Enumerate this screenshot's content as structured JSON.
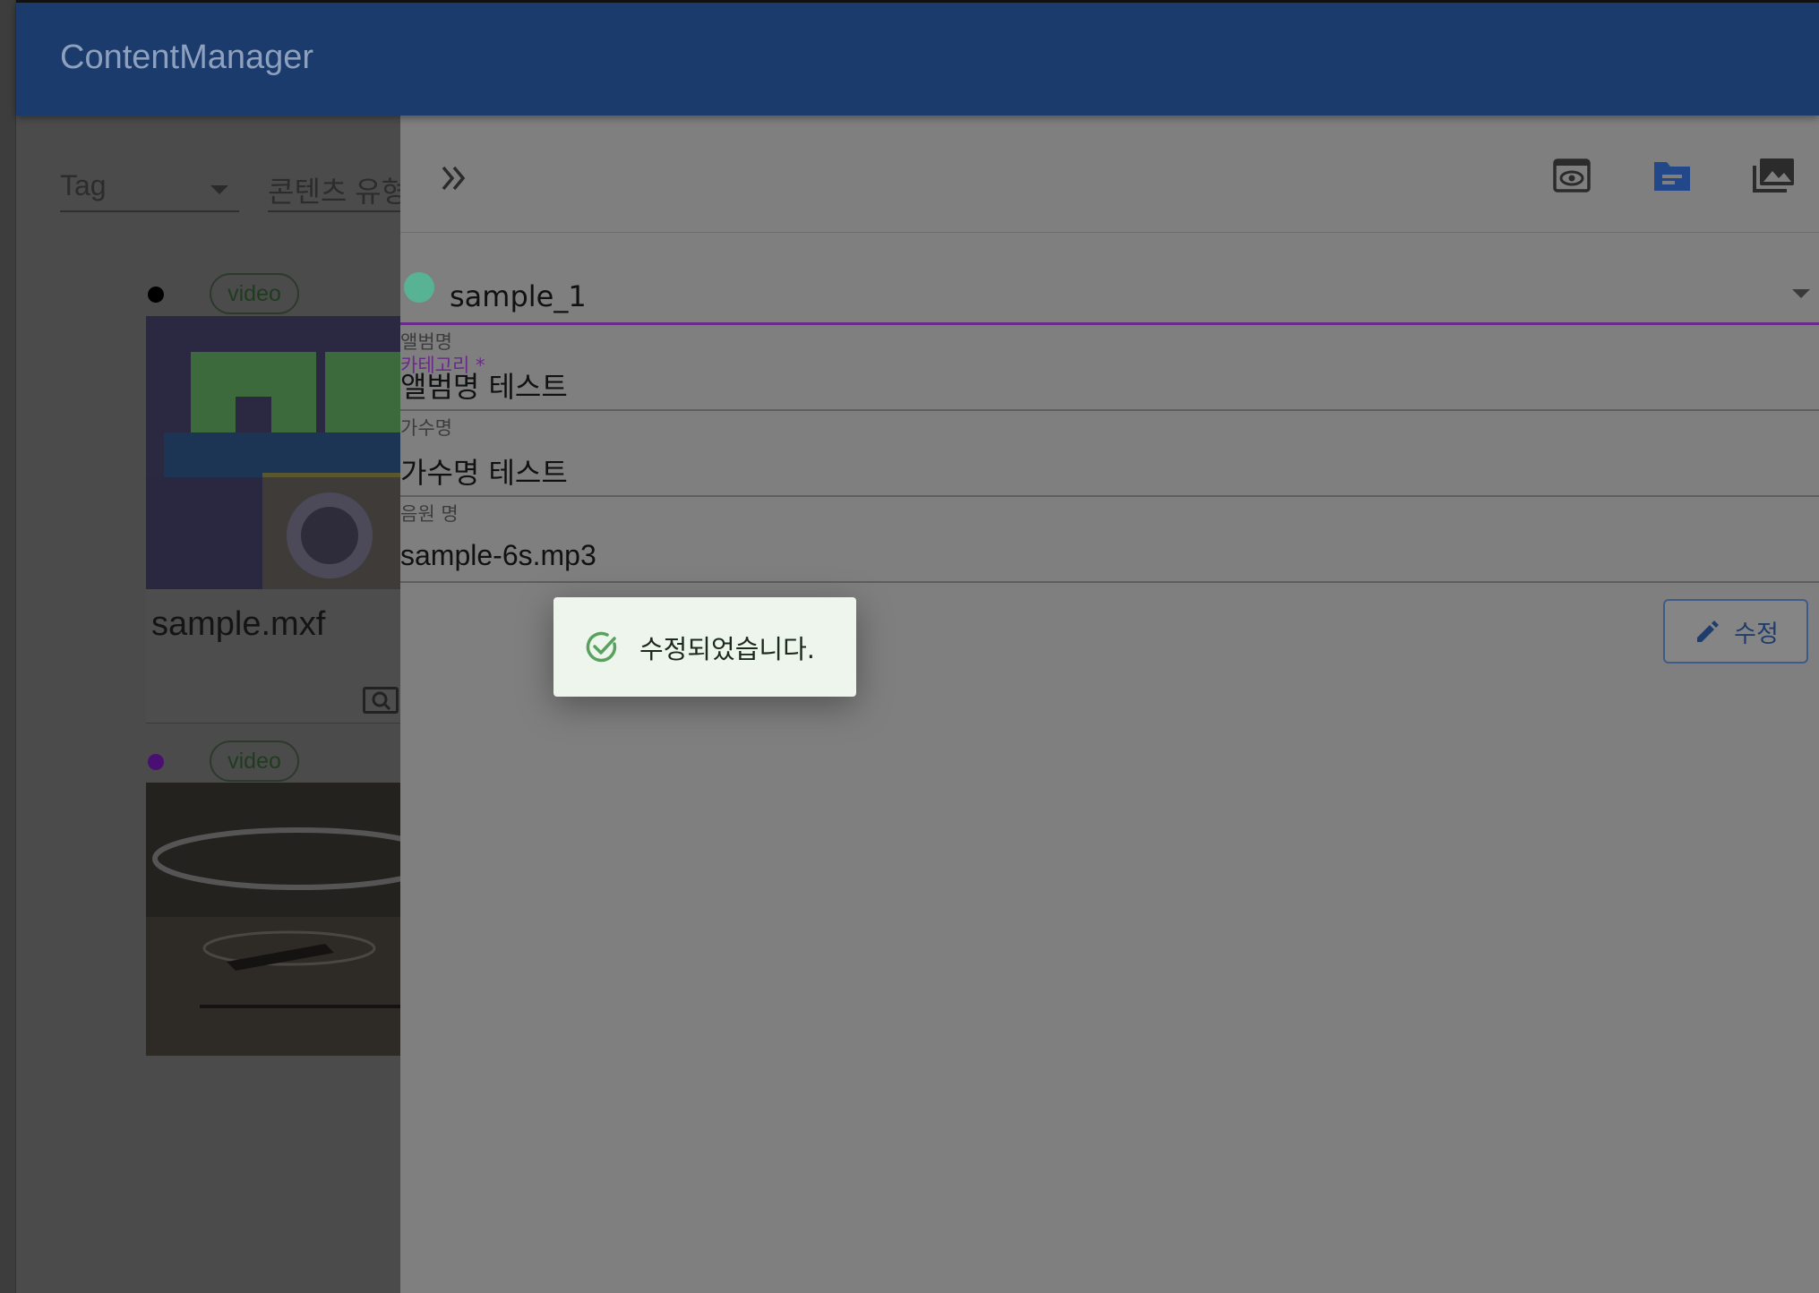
{
  "app": {
    "title": "ContentManager"
  },
  "filters": {
    "tag_label": "Tag",
    "type_label": "콘텐츠 유형"
  },
  "cards": [
    {
      "chip": "video",
      "title": "sample.mxf",
      "dot_color": "#000000"
    },
    {
      "chip": "video",
      "title": "",
      "dot_color": "#4a0f73"
    }
  ],
  "drawer": {
    "toolbar_icons": [
      "collapse-icon",
      "preview-icon",
      "folder-icon",
      "gallery-icon"
    ],
    "category": {
      "label": "카테고리 *",
      "value": "sample_1",
      "swatch_color": "#57b394"
    },
    "album": {
      "label": "앨범명",
      "value": "앨범명 테스트"
    },
    "artist": {
      "label": "가수명",
      "value": "가수명 테스트"
    },
    "track": {
      "label": "음원 명",
      "value": "sample-6s.mp3"
    },
    "edit_button_label": "수정"
  },
  "toast": {
    "message": "수정되었습니다.",
    "status_color": "#5aa05f"
  },
  "colors": {
    "appbar": "#1b3b6c",
    "accent": "#6b2a8a",
    "primary": "#1f3d6c"
  }
}
